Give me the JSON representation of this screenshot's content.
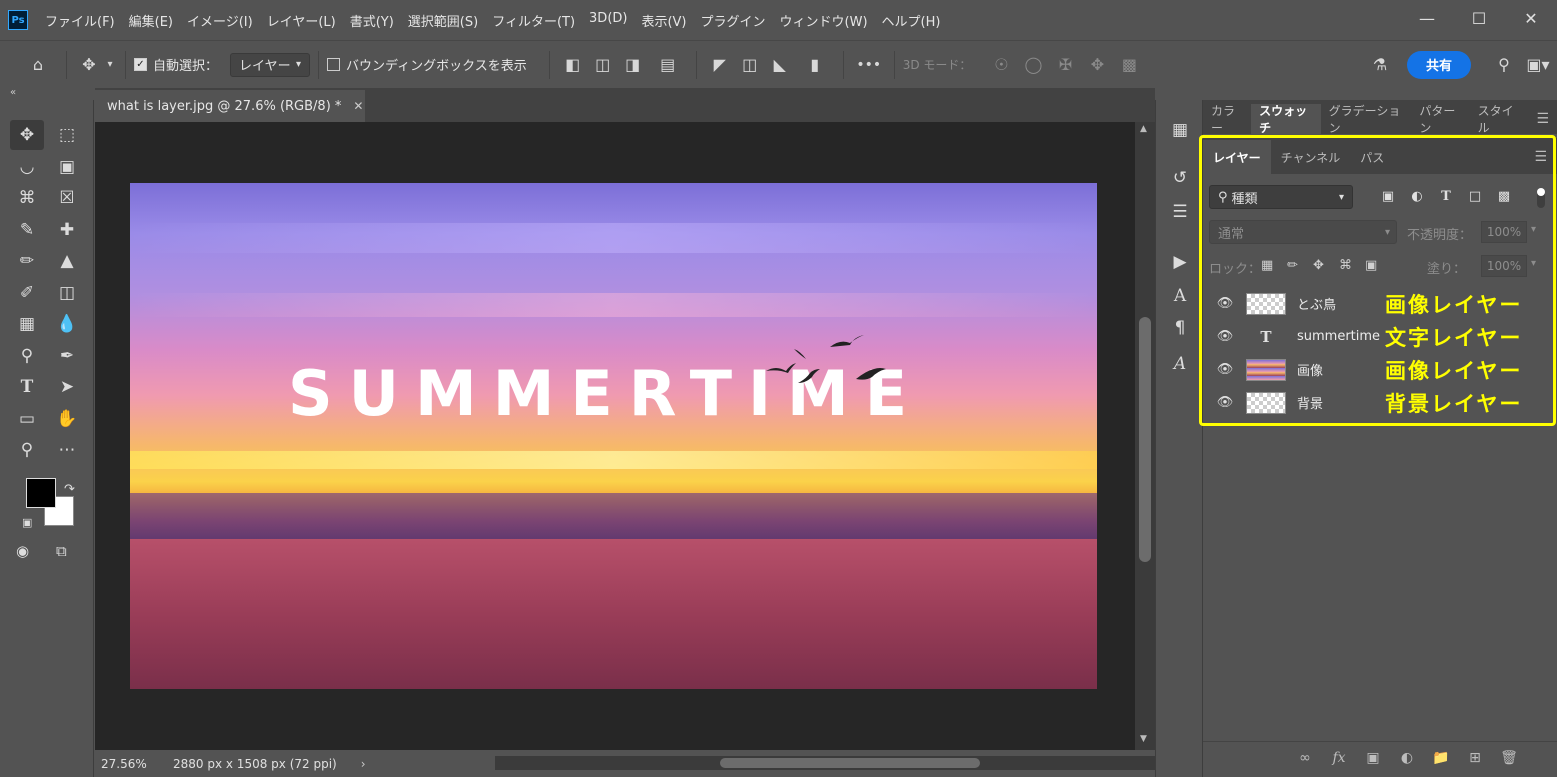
{
  "app": {
    "logo": "Ps",
    "menu": [
      "ファイル(F)",
      "編集(E)",
      "イメージ(I)",
      "レイヤー(L)",
      "書式(Y)",
      "選択範囲(S)",
      "フィルター(T)",
      "3D(D)",
      "表示(V)",
      "プラグイン",
      "ウィンドウ(W)",
      "ヘルプ(H)"
    ],
    "window_controls": [
      "minimize-icon",
      "maximize-icon",
      "close-icon"
    ]
  },
  "options_bar": {
    "auto_select_label": "自動選択：",
    "auto_select_checked": true,
    "auto_select_target": "レイヤー",
    "bounding_box_label": "バウンディングボックスを表示",
    "bounding_box_checked": false,
    "mode_3d_label": "3D モード：",
    "share_label": "共有"
  },
  "document": {
    "tab_title": "what is layer.jpg @ 27.6% (RGB/8) *",
    "image_text": "SUMMERTIME",
    "zoom": "27.56%",
    "doc_info": "2880 px x 1508 px (72 ppi)"
  },
  "colors": {
    "foreground": "#000000",
    "background": "#ffffff",
    "accent": "#1473e6",
    "highlight": "#ffff00"
  },
  "top_panel": {
    "tabs": [
      "カラー",
      "スウォッチ",
      "グラデーション",
      "パターン",
      "スタイル"
    ],
    "active_tab": "スウォッチ"
  },
  "layers_panel": {
    "tabs": [
      "レイヤー",
      "チャンネル",
      "パス"
    ],
    "active_tab": "レイヤー",
    "filter_label": "種類",
    "blend_mode": "通常",
    "opacity_label": "不透明度：",
    "opacity_value": "100%",
    "lock_label": "ロック：",
    "fill_label": "塗り：",
    "fill_value": "100%",
    "layers": [
      {
        "name": "とぶ鳥",
        "type": "pixel",
        "annotation": "画像レイヤー"
      },
      {
        "name": "summertime",
        "type": "text",
        "annotation": "文字レイヤー"
      },
      {
        "name": "画像",
        "type": "photo",
        "annotation": "画像レイヤー"
      },
      {
        "name": "背景",
        "type": "pixel",
        "annotation": "背景レイヤー"
      }
    ]
  }
}
